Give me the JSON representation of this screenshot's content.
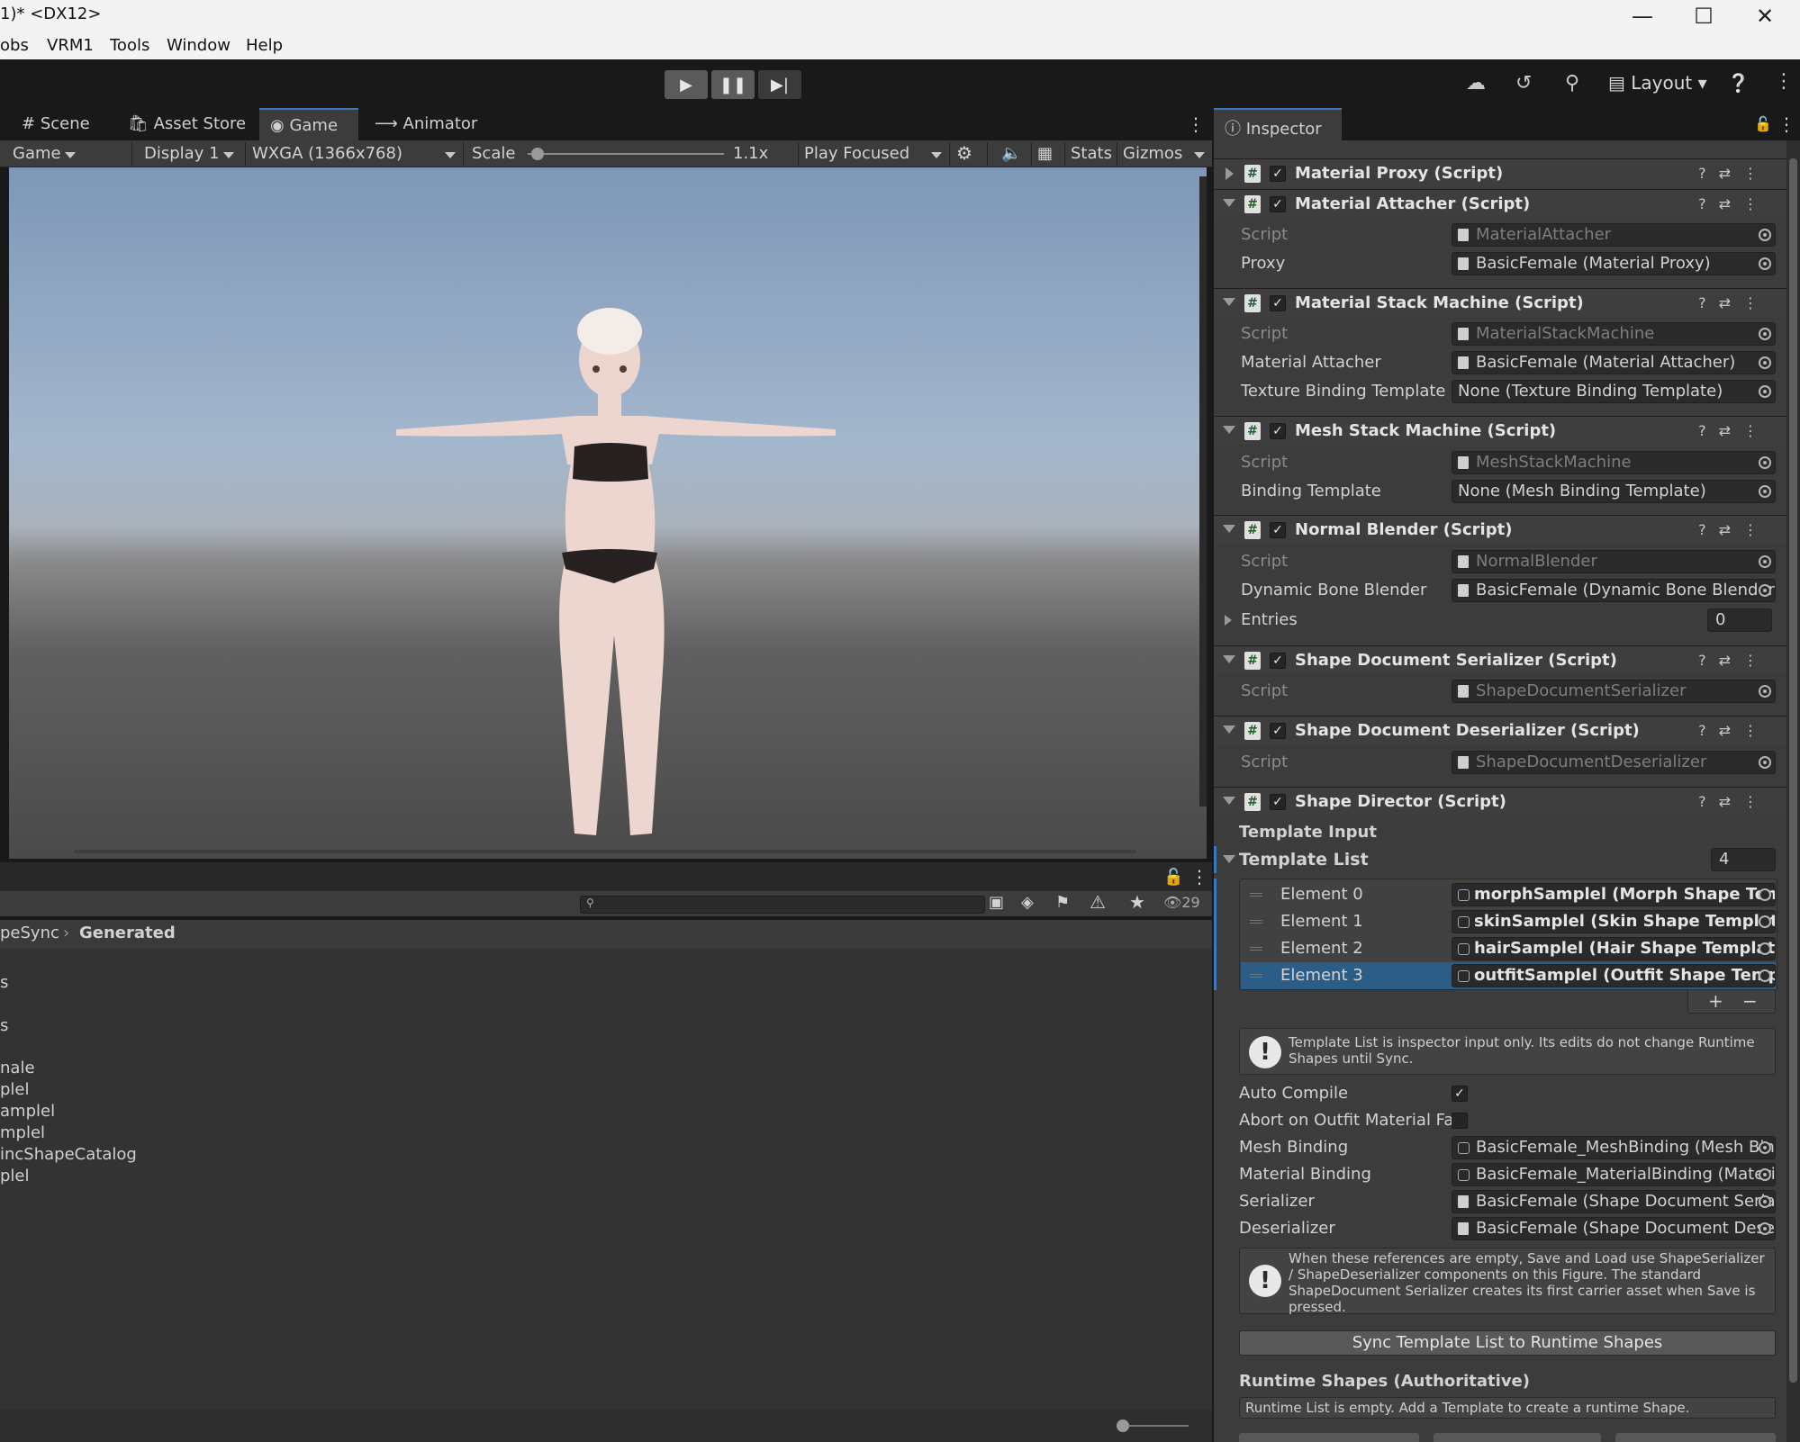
{
  "window": {
    "title": "1)* <DX12>"
  },
  "menu": [
    "obs",
    "VRM1",
    "Tools",
    "Window",
    "Help"
  ],
  "toolbar": {
    "layout_label": "Layout"
  },
  "scene_tabs": [
    "Scene",
    "Asset Store",
    "Game",
    "Animator"
  ],
  "game_bar": {
    "mode": "Game",
    "display": "Display 1",
    "resolution": "WXGA (1366x768)",
    "scale_label": "Scale",
    "scale_value": "1.1x",
    "play_mode": "Play Focused",
    "stats": "Stats",
    "gizmos": "Gizmos"
  },
  "project": {
    "visible_count": "29",
    "breadcrumb": [
      "peSync",
      "Generated"
    ],
    "items": [
      "s",
      "s",
      "nale",
      "plel",
      "amplel",
      "mplel",
      "incShapeCatalog",
      "plel"
    ]
  },
  "inspector": {
    "tab": "Inspector",
    "components": [
      {
        "title": "Material Proxy (Script)",
        "expanded": false
      },
      {
        "title": "Material Attacher (Script)",
        "fields": [
          {
            "label": "Script",
            "value": "MaterialAttacher",
            "dim": true
          },
          {
            "label": "Proxy",
            "value": "BasicFemale (Material Proxy)"
          }
        ]
      },
      {
        "title": "Material Stack Machine (Script)",
        "fields": [
          {
            "label": "Script",
            "value": "MaterialStackMachine",
            "dim": true
          },
          {
            "label": "Material Attacher",
            "value": "BasicFemale (Material Attacher)"
          },
          {
            "label": "Texture Binding Template",
            "value": "None (Texture Binding Template)"
          }
        ]
      },
      {
        "title": "Mesh Stack Machine (Script)",
        "fields": [
          {
            "label": "Script",
            "value": "MeshStackMachine",
            "dim": true
          },
          {
            "label": "Binding Template",
            "value": "None (Mesh Binding Template)"
          }
        ]
      },
      {
        "title": "Normal Blender (Script)",
        "fields": [
          {
            "label": "Script",
            "value": "NormalBlender",
            "dim": true
          },
          {
            "label": "Dynamic Bone Blender",
            "value": "BasicFemale (Dynamic Bone Blender)"
          },
          {
            "label": "Entries",
            "value": "0"
          }
        ]
      },
      {
        "title": "Shape Document Serializer (Script)",
        "fields": [
          {
            "label": "Script",
            "value": "ShapeDocumentSerializer",
            "dim": true
          }
        ]
      },
      {
        "title": "Shape Document Deserializer (Script)",
        "fields": [
          {
            "label": "Script",
            "value": "ShapeDocumentDeserializer",
            "dim": true
          }
        ]
      },
      {
        "title": "Shape Director (Script)"
      }
    ],
    "shape_director": {
      "template_input": "Template Input",
      "template_list_label": "Template List",
      "template_list_count": "4",
      "elements": [
        {
          "label": "Element 0",
          "value": "morphSamplel (Morph Shape Template)"
        },
        {
          "label": "Element 1",
          "value": "skinSamplel (Skin Shape Template)"
        },
        {
          "label": "Element 2",
          "value": "hairSamplel (Hair Shape Template)"
        },
        {
          "label": "Element 3",
          "value": "outfitSamplel (Outfit Shape Template)",
          "selected": true
        }
      ],
      "help1": "Template List is inspector input only. Its edits do not change Runtime Shapes until Sync.",
      "auto_compile": {
        "label": "Auto Compile",
        "checked": true
      },
      "abort_outfit": {
        "label": "Abort on Outfit Material Fail",
        "checked": false
      },
      "refs": [
        {
          "label": "Mesh Binding",
          "value": "BasicFemale_MeshBinding (Mesh Binding)"
        },
        {
          "label": "Material Binding",
          "value": "BasicFemale_MaterialBinding (Material Binding)"
        },
        {
          "label": "Serializer",
          "value": "BasicFemale (Shape Document Serializer)"
        },
        {
          "label": "Deserializer",
          "value": "BasicFemale (Shape Document Deserializer)"
        }
      ],
      "help2": "When these references are empty, Save and Load use ShapeSerializer / ShapeDeserializer components on this Figure. The standard ShapeDocument Serializer creates its first carrier asset when Save is pressed.",
      "sync_button": "Sync Template List to Runtime Shapes",
      "runtime_title": "Runtime Shapes (Authoritative)",
      "runtime_empty": "Runtime List is empty. Add a Template to create a runtime Shape."
    }
  },
  "colors": {
    "accent": "#3a79bb",
    "selection": "#2c5d87",
    "panel": "#3c3c3c"
  }
}
